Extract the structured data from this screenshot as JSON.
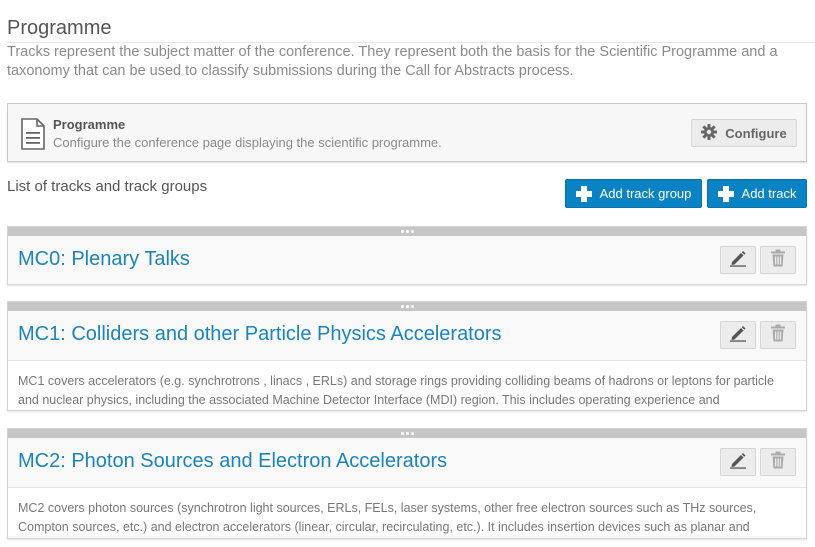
{
  "page": {
    "title": "Programme",
    "intro": "Tracks represent the subject matter of the conference. They represent both the basis for the Scientific Programme and a taxonomy that can be used to classify submissions during the Call for Abstracts process."
  },
  "programme_box": {
    "title": "Programme",
    "description": "Configure the conference page displaying the scientific programme.",
    "configure_label": "Configure"
  },
  "list": {
    "heading": "List of tracks and track groups",
    "add_group_label": "Add track group",
    "add_track_label": "Add track"
  },
  "tracks": [
    {
      "title": "MC0: Plenary Talks",
      "description": ""
    },
    {
      "title": "MC1: Colliders and other Particle Physics Accelerators",
      "description": "MC1 covers accelerators (e.g. synchrotrons , linacs , ERLs) and storage rings providing colliding beams of hadrons or leptons for particle and nuclear physics, including the associated Machine Detector Interface (MDI) region. This includes operating experience and"
    },
    {
      "title": "MC2: Photon Sources and Electron Accelerators",
      "description": "MC2 covers photon sources (synchrotron light sources, ERLs, FELs, laser systems, other free electron sources such as THz sources, Compton sources, etc.) and electron accelerators (linear, circular, recirculating, etc.). It includes insertion devices such as planar and"
    }
  ],
  "icons": {
    "document": "document-icon",
    "gear": "gear-icon",
    "plus": "plus-icon",
    "edit": "pencil-icon",
    "delete": "trash-icon",
    "handle": "drag-handle-icon"
  },
  "colors": {
    "accent": "#0a83c4",
    "link": "#1a84c0",
    "handle": "#c6c6c6"
  }
}
